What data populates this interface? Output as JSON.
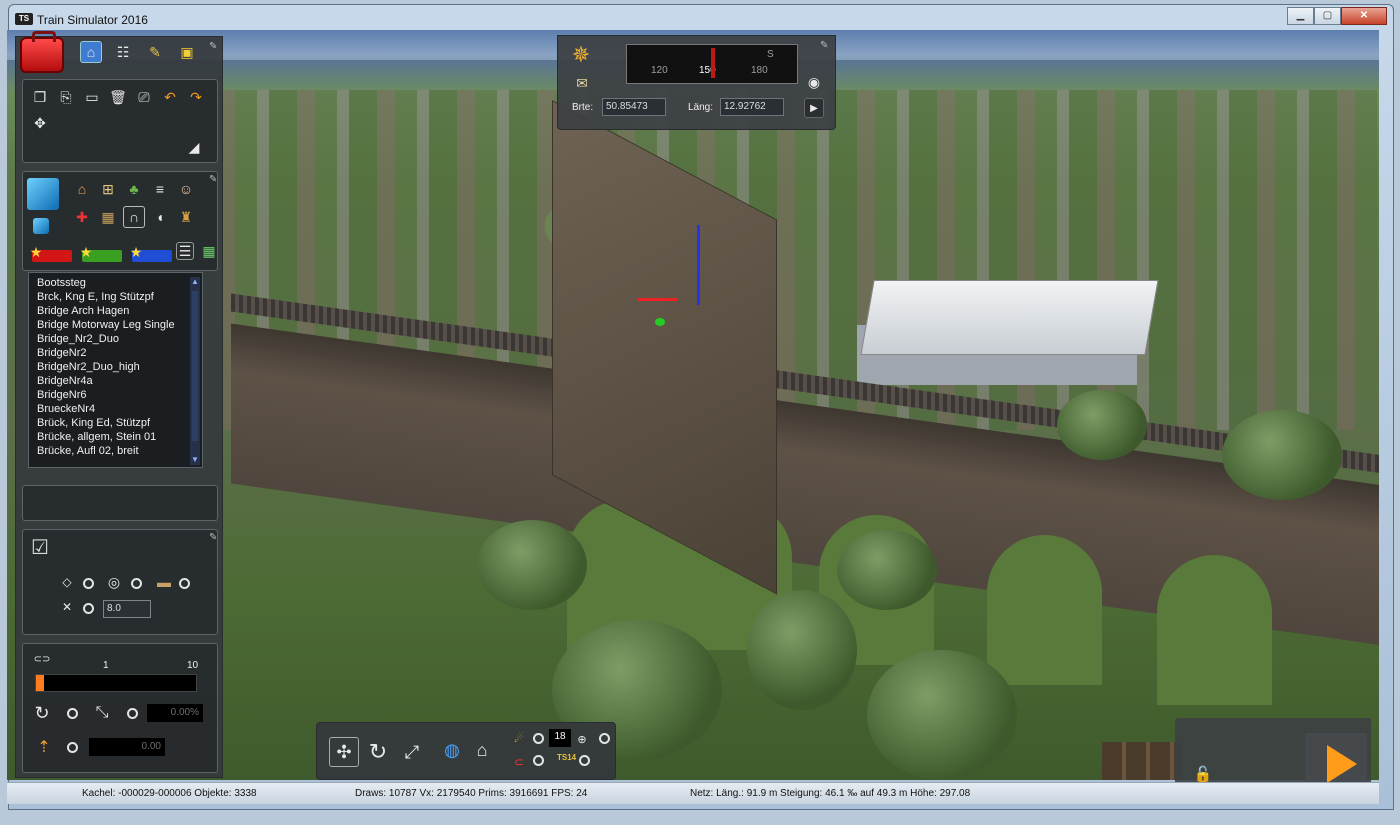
{
  "window": {
    "title": "Train Simulator 2016",
    "app_badge": "TS"
  },
  "library": {
    "items": [
      "Bootssteg",
      "Brck, Kng E, Ing Stützpf",
      "Bridge Arch Hagen",
      "Bridge Motorway Leg Single",
      "Bridge_Nr2_Duo",
      "BridgeNr2",
      "BridgeNr2_Duo_high",
      "BridgeNr4a",
      "BridgeNr6",
      "BrueckeNr4",
      "Brück, King Ed, Stützpf",
      "Brücke, allgem, Stein 01",
      "Brücke, Aufl 02, breit"
    ]
  },
  "placement": {
    "value": "8.0"
  },
  "density": {
    "min_label": "1",
    "max_label": "10",
    "level": 0.05
  },
  "rotation": {
    "value": "0.00%",
    "height_value": "0.00"
  },
  "compass": {
    "ticks": [
      "120",
      "150",
      "180"
    ],
    "south_label": "S",
    "lat_label": "Brte:",
    "lat_value": "50.85473",
    "lon_label": "Läng:",
    "lon_value": "12.92762"
  },
  "bottom_toolbar": {
    "counter": "18",
    "ts14_label": "TS14"
  },
  "statusbar": {
    "kachel": "Kachel: -000029-000006  Objekte: 3338",
    "draws": "Draws: 10787 Vx: 2179540 Prims: 3916691 FPS: 24",
    "netz": "Netz:  Läng.:   91.9 m Steigung: 46.1 ‰ auf 49.3 m Hӧhe: 297.08"
  },
  "colors": {
    "accent_play": "#ff9c1a",
    "toolbox": "#e02020",
    "star_red": "#d21515",
    "star_green": "#3aa022",
    "star_blue": "#1f4dd4"
  }
}
